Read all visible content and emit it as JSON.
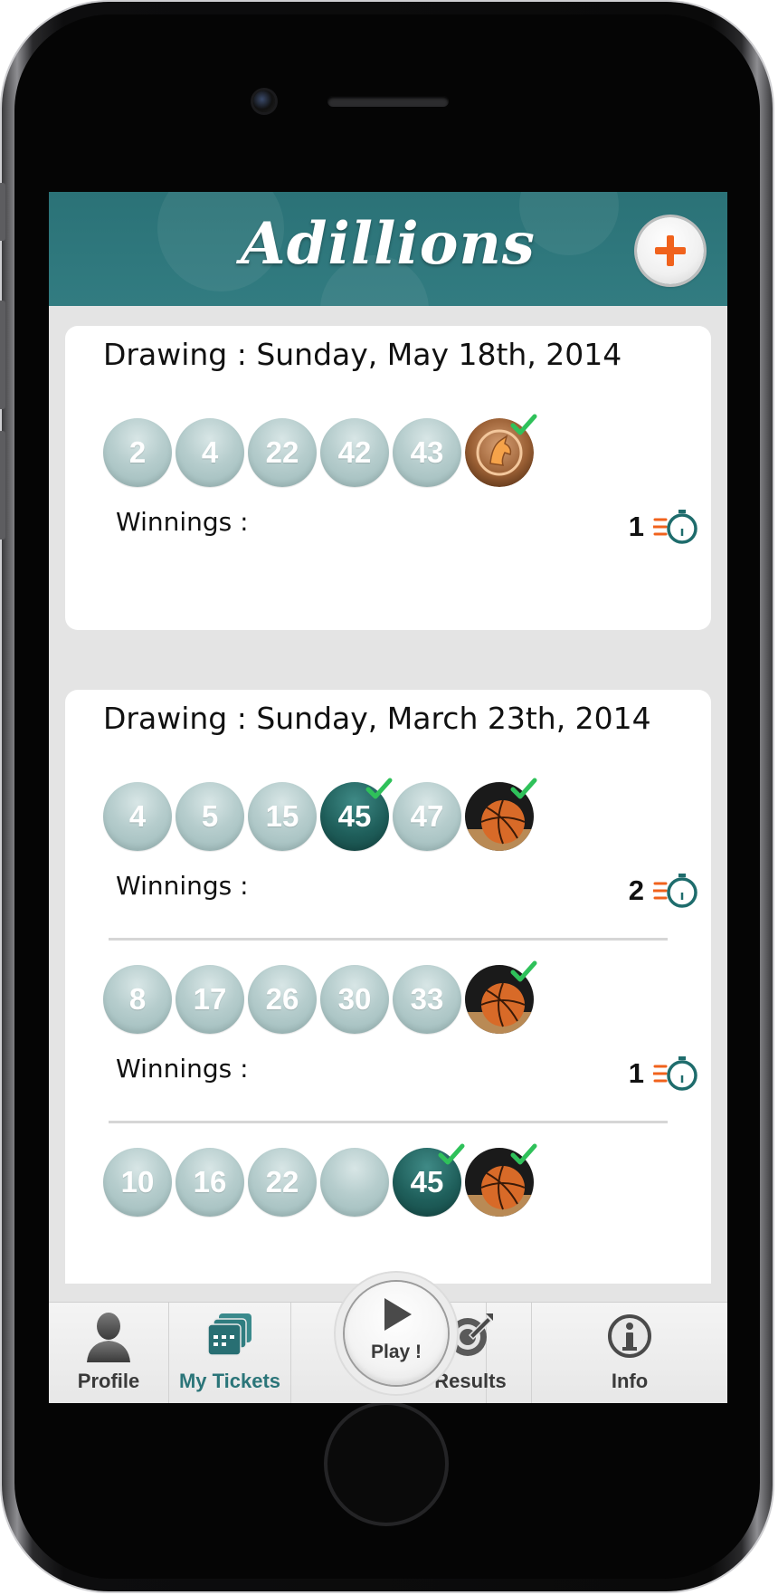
{
  "header": {
    "title": "Adillions"
  },
  "draws": [
    {
      "title": "Drawing : Sunday, May 18th, 2014",
      "tickets": [
        {
          "numbers": [
            "2",
            "4",
            "22",
            "42",
            "43"
          ],
          "matched": [
            false,
            false,
            false,
            false,
            false
          ],
          "bonus": "horse-sign-icon",
          "winnings_label": "Winnings :",
          "multiplier": "1"
        }
      ]
    },
    {
      "title": "Drawing : Sunday, March 23th, 2014",
      "tickets": [
        {
          "numbers": [
            "4",
            "5",
            "15",
            "45",
            "47"
          ],
          "matched": [
            false,
            false,
            false,
            true,
            false
          ],
          "bonus": "basketball-icon",
          "winnings_label": "Winnings :",
          "multiplier": "2"
        },
        {
          "numbers": [
            "8",
            "17",
            "26",
            "30",
            "33"
          ],
          "matched": [
            false,
            false,
            false,
            false,
            false
          ],
          "bonus": "basketball-icon",
          "winnings_label": "Winnings :",
          "multiplier": "1"
        },
        {
          "numbers": [
            "10",
            "16",
            "22",
            "",
            "45"
          ],
          "matched": [
            false,
            false,
            false,
            false,
            true
          ],
          "bonus": "basketball-icon"
        }
      ]
    }
  ],
  "tabbar": {
    "profile": "Profile",
    "my_tickets": "My Tickets",
    "play": "Play !",
    "results": "Results",
    "info": "Info"
  },
  "colors": {
    "header": "#2f787d",
    "ball": "#b6cdcd",
    "ball_matched": "#1f5f5b",
    "check": "#2fc15a",
    "plus": "#f0621c",
    "active_tab": "#2b7579"
  }
}
